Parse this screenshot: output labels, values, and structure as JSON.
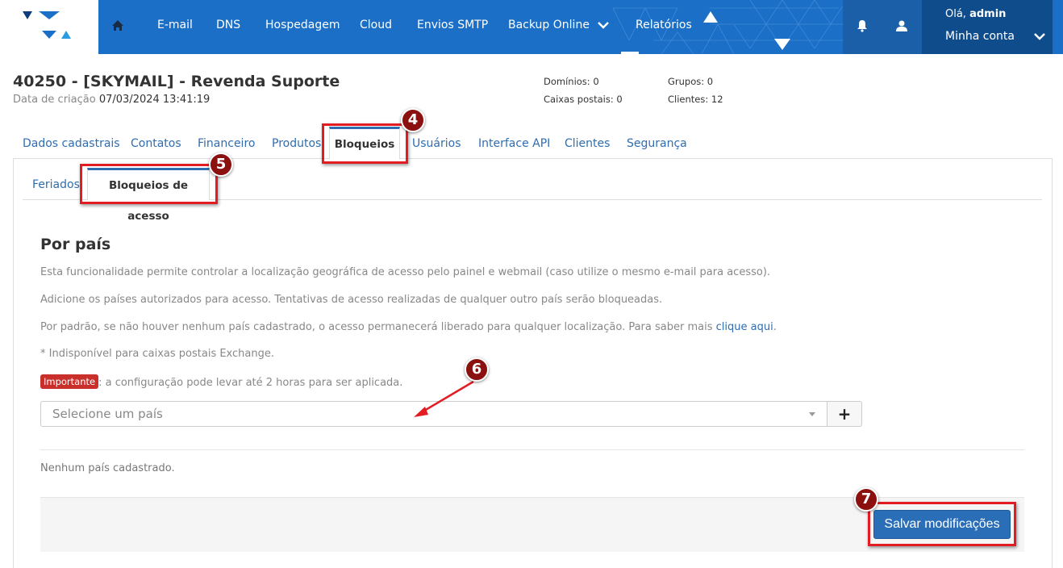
{
  "nav": {
    "items": [
      "E-mail",
      "DNS",
      "Hospedagem",
      "Cloud",
      "Envios SMTP",
      "Backup Online",
      "Relatórios"
    ],
    "greeting": "Olá,",
    "username": "admin",
    "account_label": "Minha conta"
  },
  "header": {
    "title": "40250 - [SKYMAIL] - Revenda Suporte",
    "created_label": "Data de criação",
    "created_value": "07/03/2024 13:41:19",
    "stats": {
      "dominios": "Domínios: 0",
      "caixas": "Caixas postais: 0",
      "grupos": "Grupos: 0",
      "clientes": "Clientes: 12"
    }
  },
  "tabs": [
    "Dados cadastrais",
    "Contatos",
    "Financeiro",
    "Produtos",
    "Bloqueios",
    "Usuários",
    "Interface API",
    "Clientes",
    "Segurança"
  ],
  "active_tab": "Bloqueios",
  "subtabs": {
    "feriados": "Feriados",
    "bloqueios_acesso": "Bloqueios de acesso"
  },
  "section": {
    "title": "Por país",
    "p1": "Esta funcionalidade permite controlar a localização geográfica de acesso pelo painel e webmail (caso utilize o mesmo e-mail para acesso).",
    "p2": "Adicione os países autorizados para acesso. Tentativas de acesso realizadas de qualquer outro país serão bloqueadas.",
    "p3": "Por padrão, se não houver nenhum país cadastrado, o acesso permanecerá liberado para qualquer localização. Para saber mais",
    "p3_link": "clique aqui",
    "p3_end": ".",
    "p4": "* Indisponível para caixas postais Exchange.",
    "badge": "Importante",
    "p5": ": a configuração pode levar até 2 horas para ser aplicada.",
    "select_placeholder": "Selecione um país",
    "add_label": "+",
    "empty_text": "Nenhum país cadastrado.",
    "save_label": "Salvar modificações"
  },
  "annotations": [
    "4",
    "5",
    "6",
    "7"
  ],
  "colors": {
    "nav_bg": "#1b6fc7",
    "account_bg": "#0f4c8c",
    "link": "#2f6db0",
    "badge": "#c9302c",
    "annotation_red": "#e31b23",
    "marker": "#8b1010",
    "save_button": "#2a6eb7"
  }
}
